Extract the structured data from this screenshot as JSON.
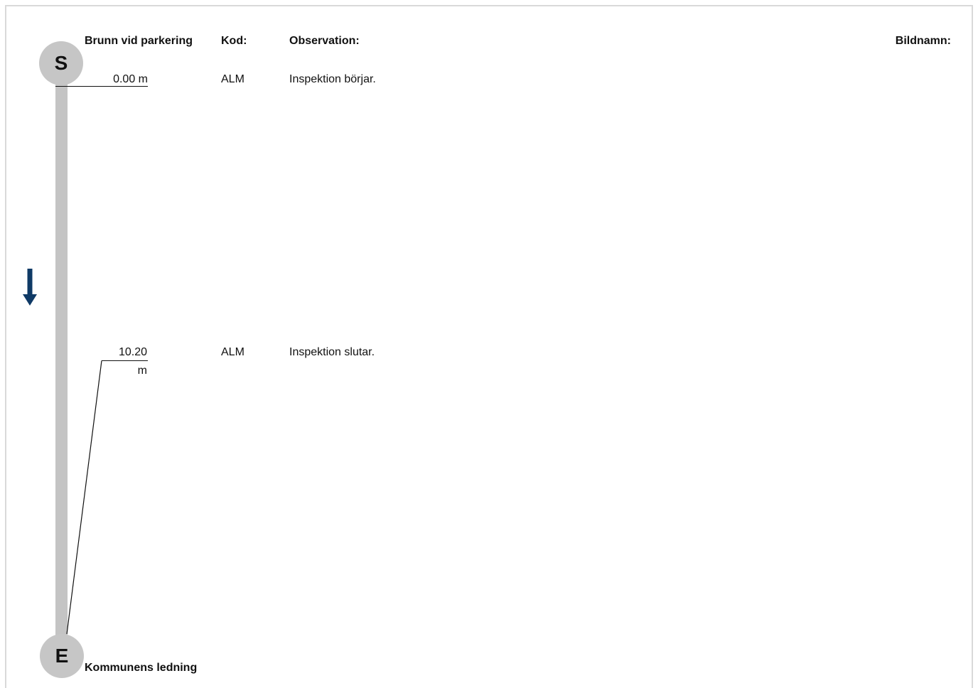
{
  "section": {
    "start_node": {
      "letter": "S",
      "name": "Brunn vid parkering"
    },
    "end_node": {
      "letter": "E",
      "name": "Kommunens ledning"
    }
  },
  "headers": {
    "kod": "Kod:",
    "observation": "Observation:",
    "bildnamn": "Bildnamn:"
  },
  "observations": [
    {
      "distance": "0.00 m",
      "code": "ALM",
      "text": "Inspektion börjar."
    },
    {
      "distance_line1": "10.20",
      "distance_line2": "m",
      "code": "ALM",
      "text": "Inspektion slutar."
    }
  ],
  "direction_icon": "arrow-down-icon",
  "colors": {
    "pipe": "#c4c4c4",
    "node": "#c6c6c6",
    "arrow": "#0f3a66",
    "frame": "#d9d9d9"
  }
}
